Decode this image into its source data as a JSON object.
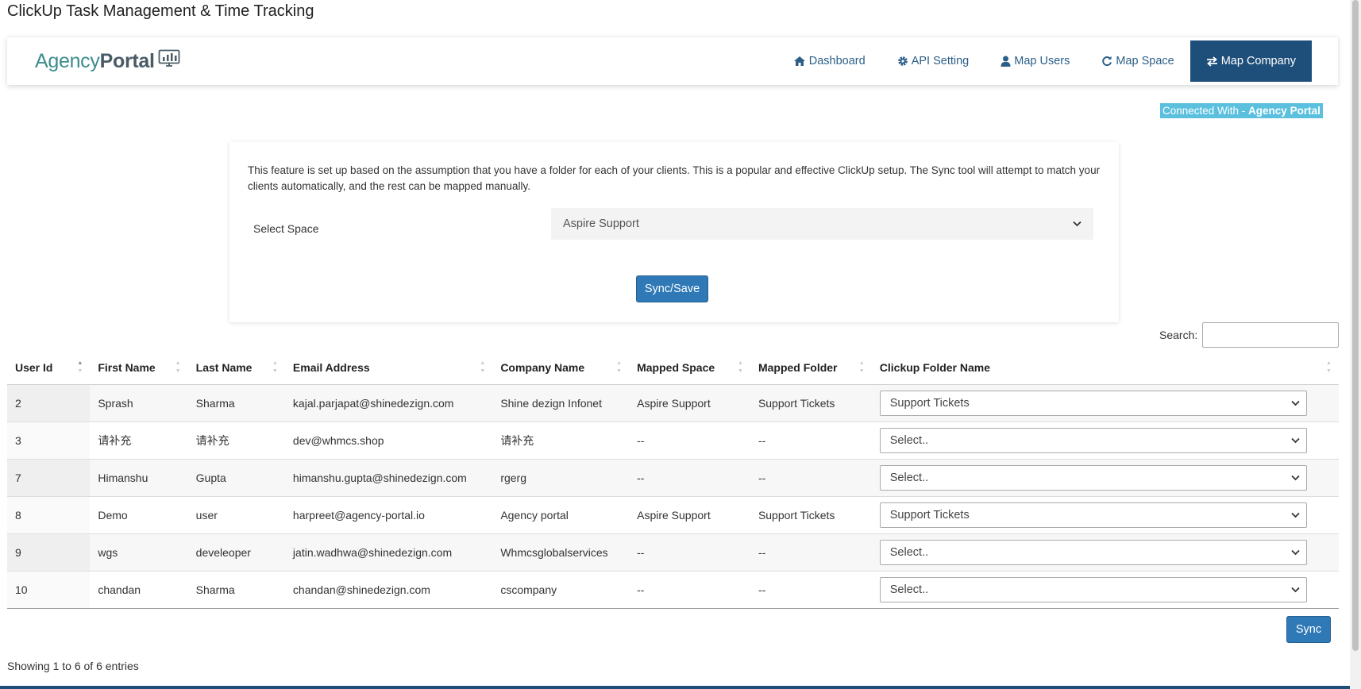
{
  "page": {
    "title": "ClickUp Task Management & Time Tracking"
  },
  "logo": {
    "part1": "Agency",
    "part2": "Portal"
  },
  "nav": {
    "items": [
      {
        "label": "Dashboard",
        "icon": "home-icon"
      },
      {
        "label": "API Setting",
        "icon": "gear-icon"
      },
      {
        "label": "Map Users",
        "icon": "user-icon"
      },
      {
        "label": "Map Space",
        "icon": "refresh-icon"
      },
      {
        "label": "Map Company",
        "icon": "exchange-icon",
        "active": true
      }
    ]
  },
  "connected": {
    "prefix": "Connected With - ",
    "name": "Agency Portal"
  },
  "card": {
    "description": "This feature is set up based on the assumption that you have a folder for each of your clients. This is a popular and effective ClickUp setup. The Sync tool will attempt to match your clients automatically, and the rest can be mapped manually.",
    "select_label": "Select Space",
    "select_value": "Aspire Support",
    "button_label": "Sync/Save"
  },
  "search": {
    "label": "Search:",
    "value": ""
  },
  "table": {
    "columns": [
      "User Id",
      "First Name",
      "Last Name",
      "Email Address",
      "Company Name",
      "Mapped Space",
      "Mapped Folder",
      "Clickup Folder Name"
    ],
    "rows": [
      [
        "2",
        "Sprash",
        "Sharma",
        "kajal.parjapat@shinedezign.com",
        "Shine dezign Infonet",
        "Aspire Support",
        "Support Tickets",
        "Support Tickets"
      ],
      [
        "3",
        "请补充",
        "请补充",
        "dev@whmcs.shop",
        "请补充",
        "--",
        "--",
        "Select.."
      ],
      [
        "7",
        "Himanshu",
        "Gupta",
        "himanshu.gupta@shinedezign.com",
        "rgerg",
        "--",
        "--",
        "Select.."
      ],
      [
        "8",
        "Demo",
        "user",
        "harpreet@agency-portal.io",
        "Agency portal",
        "Aspire Support",
        "Support Tickets",
        "Support Tickets"
      ],
      [
        "9",
        "wgs",
        "develeoper",
        "jatin.wadhwa@shinedezign.com",
        "Whmcsglobalservices",
        "--",
        "--",
        "Select.."
      ],
      [
        "10",
        "chandan",
        "Sharma",
        "chandan@shinedezign.com",
        "cscompany",
        "--",
        "--",
        "Select.."
      ]
    ]
  },
  "footer": {
    "sync_label": "Sync",
    "showing": "Showing 1 to 6 of 6 entries"
  },
  "colors": {
    "primary": "#2e79b6",
    "nav_active": "#1e4f7a",
    "badge": "#5bc0de",
    "logo_teal": "#3d8c8e"
  }
}
